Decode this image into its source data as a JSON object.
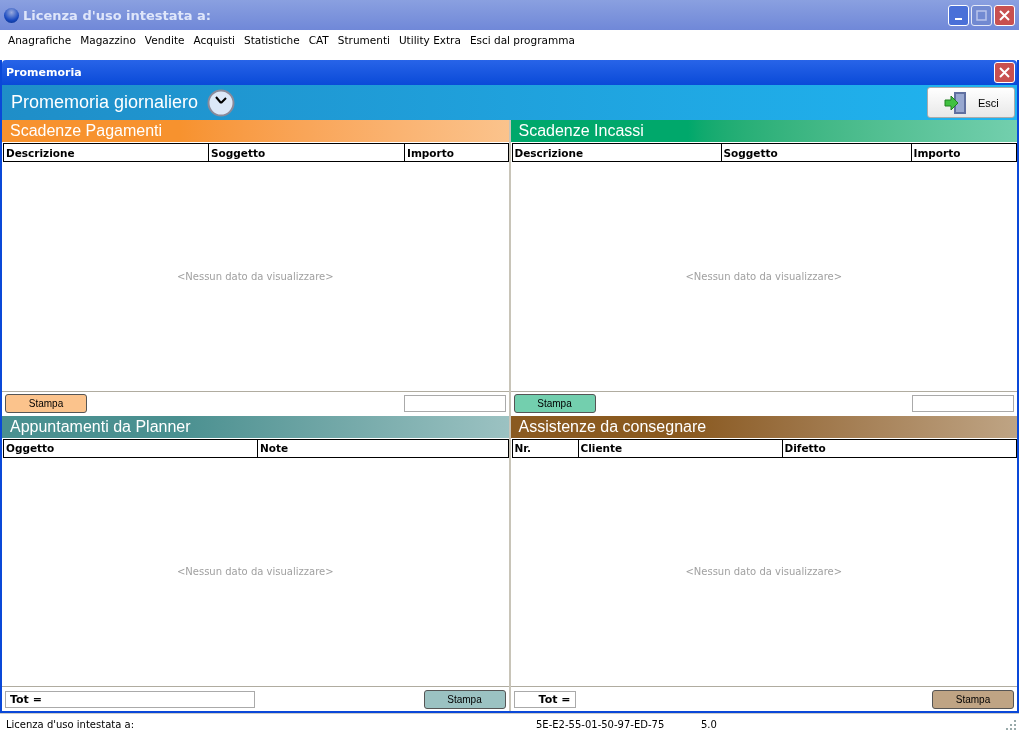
{
  "window": {
    "title": "Licenza d'uso intestata a:"
  },
  "menu": [
    "Anagrafiche",
    "Magazzino",
    "Vendite",
    "Acquisti",
    "Statistiche",
    "CAT",
    "Strumenti",
    "Utility Extra",
    "Esci dal programma"
  ],
  "child_window": {
    "title": "Promemoria"
  },
  "header": {
    "title": "Promemoria giornaliero",
    "exit_button": "Esci"
  },
  "panels": [
    {
      "title": "Scadenze Pagamenti",
      "color": "#f7922e",
      "columns": [
        "Descrizione",
        "Soggetto",
        "Importo"
      ],
      "empty_text": "<Nessun dato da visualizzare>",
      "footer": {
        "kind": "button_left",
        "button": "Stampa"
      }
    },
    {
      "title": "Scadenze Incassi",
      "color": "#00a86b",
      "columns": [
        "Descrizione",
        "Soggetto",
        "Importo"
      ],
      "empty_text": "<Nessun dato da visualizzare>",
      "footer": {
        "kind": "button_left",
        "button": "Stampa"
      }
    },
    {
      "title": "Appuntamenti da Planner",
      "color": "#4a9090",
      "columns": [
        "Oggetto",
        "Note"
      ],
      "empty_text": "<Nessun dato da visualizzare>",
      "footer": {
        "kind": "total_wide",
        "total": "Tot =",
        "button": "Stampa"
      }
    },
    {
      "title": "Assistenze da consegnare",
      "color": "#8a5a20",
      "columns": [
        "Nr.",
        "Cliente",
        "Difetto"
      ],
      "empty_text": "<Nessun dato da visualizzare>",
      "footer": {
        "kind": "total_small",
        "total": "Tot =",
        "button": "Stampa"
      }
    }
  ],
  "status_bar": {
    "license": "Licenza d'uso intestata a:",
    "code": "5E-E2-55-01-50-97-ED-75",
    "version": "5.0"
  }
}
